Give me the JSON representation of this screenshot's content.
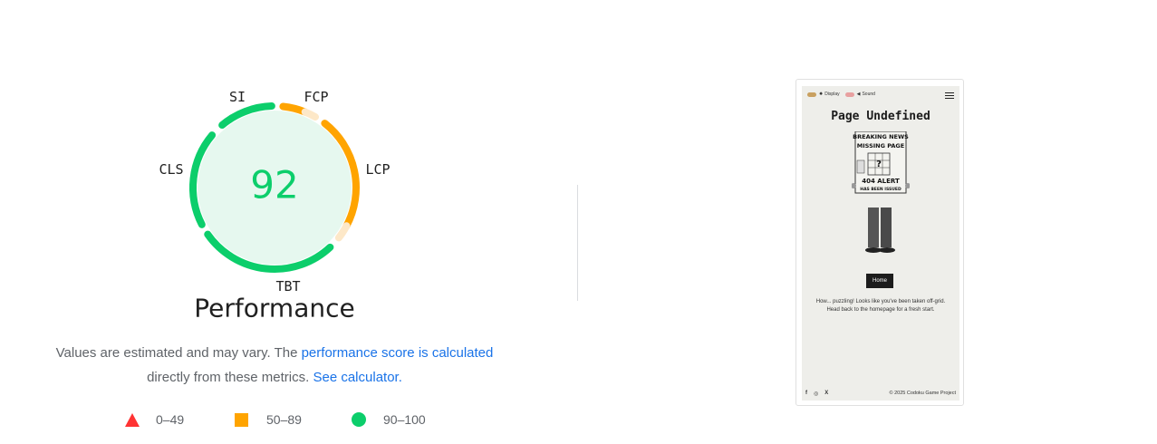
{
  "gauge": {
    "score": "92",
    "metrics": {
      "si": "SI",
      "fcp": "FCP",
      "lcp": "LCP",
      "tbt": "TBT",
      "cls": "CLS"
    },
    "title": "Performance",
    "colors": {
      "pass": "#0cce6b",
      "average": "#ffa400",
      "fail": "#ff3333",
      "fill": "#e6f8ef",
      "track_average": "#fde8c8"
    }
  },
  "description": {
    "prefix": "Values are estimated and may vary. The ",
    "link1": "performance score is calculated",
    "middle": "directly from these metrics.",
    "link2": "See calculator."
  },
  "legend": [
    {
      "range": "0–49",
      "icon": "triangle-icon"
    },
    {
      "range": "50–89",
      "icon": "square-icon"
    },
    {
      "range": "90–100",
      "icon": "circle-icon"
    }
  ],
  "thumbnail": {
    "toggle1": "Display",
    "toggle2": "Sound",
    "title": "Page Undefined",
    "newspaper": {
      "headline1": "BREAKING NEWS",
      "headline2": "MISSING PAGE",
      "symbol": "?",
      "alert1": "404 ALERT",
      "alert2": "HAS BEEN ISSUED"
    },
    "home_button": "Home",
    "message_line1": "How... puzzling! Looks like you've been taken off-grid.",
    "message_line2": "Head back to the homepage for a fresh start.",
    "social": [
      "f",
      "◎",
      "X"
    ],
    "copyright": "© 2025 Codoku Game Project"
  }
}
